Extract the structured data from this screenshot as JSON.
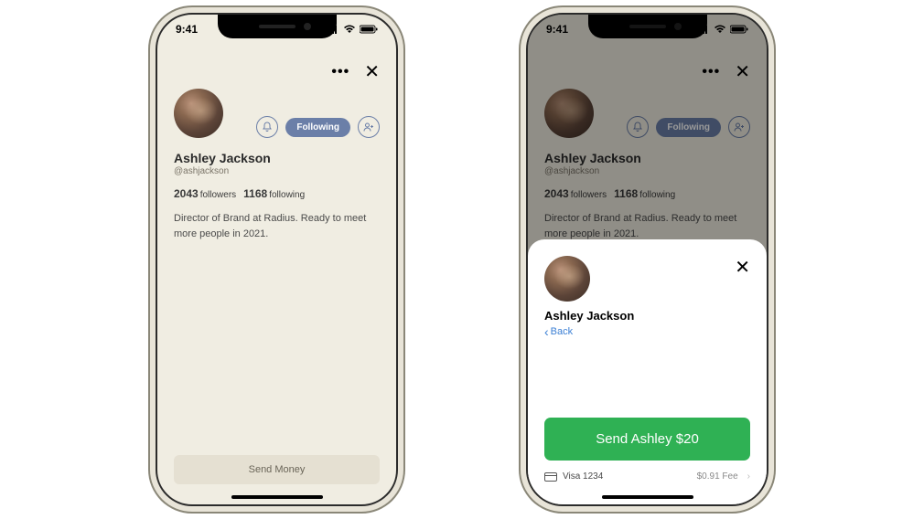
{
  "status": {
    "time": "9:41"
  },
  "profile": {
    "name": "Ashley Jackson",
    "handle": "@ashjackson",
    "followers": "2043",
    "followers_label": "followers",
    "following": "1168",
    "following_label": "following",
    "bio": "Director of Brand at Radius. Ready to meet more people in 2021.",
    "follow_state": "Following"
  },
  "actions": {
    "send_money": "Send Money"
  },
  "sheet": {
    "name": "Ashley Jackson",
    "back": "Back",
    "send_label": "Send Ashley $20",
    "card": "Visa 1234",
    "fee": "$0.91 Fee"
  }
}
